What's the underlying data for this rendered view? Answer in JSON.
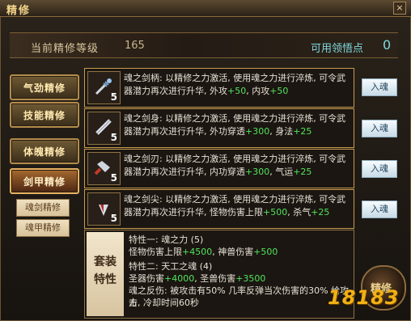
{
  "window": {
    "title": "精修",
    "close_label": "×"
  },
  "level": {
    "label": "当前精修等级",
    "value": "165",
    "points_label": "可用领悟点",
    "points_value": "0"
  },
  "tabs": [
    "气劲精修",
    "技能精修",
    "体魄精修",
    "剑甲精修"
  ],
  "subtabs": [
    "魂剑精修",
    "魂甲精修"
  ],
  "rows": [
    {
      "name": "魂之剑柄",
      "level": "5",
      "line1": "魂之剑柄: 以精修之力激活, 使用魂之力进行淬炼, 可令武",
      "line2a": "器潜力再次进行升华, 外攻",
      "g1": "+50",
      "mid": ", 内攻",
      "g2": "+50",
      "button": "入魂",
      "icon": "sword-hilt-icon"
    },
    {
      "name": "魂之剑身",
      "level": "5",
      "line1": "魂之剑身: 以精修之力激活, 使用魂之力进行淬炼, 可令武",
      "line2a": "器潜力再次进行升华, 外功穿透",
      "g1": "+300",
      "mid": ", 身法",
      "g2": "+25",
      "button": "入魂",
      "icon": "sword-blade-icon"
    },
    {
      "name": "魂之剑刃",
      "level": "5",
      "line1": "魂之剑刃: 以精修之力激活, 使用魂之力进行淬炼, 可令武",
      "line2a": "器潜力再次进行升华, 内功穿透",
      "g1": "+300",
      "mid": ", 气运",
      "g2": "+25",
      "button": "入魂",
      "icon": "sword-edge-icon"
    },
    {
      "name": "魂之剑尖",
      "level": "5",
      "line1": "魂之剑尖: 以精修之力激活, 使用魂之力进行淬炼, 可令武",
      "line2a": "器潜力再次进行升华, 怪物伤害上限",
      "g1": "+500",
      "mid": ", 杀气",
      "g2": "+25",
      "button": "入魂",
      "icon": "sword-tip-icon"
    }
  ],
  "set": {
    "label1": "套装",
    "label2": "特性",
    "t1": "特性一: 魂之力 (5)",
    "t1a": "怪物伤害上限",
    "t1av": "+4500",
    "t1b": ", 神兽伤害",
    "t1bv": "+500",
    "t2": "特性二: 天工之魂 (4)",
    "t2a": "圣器伤害",
    "t2av": "+4000",
    "t2b": ", 圣兽伤害",
    "t2bv": "+3500",
    "t2c": "魂之反伤: 被攻击有50% 几率反弹当次伤害的30% 给攻击",
    "t2d": "方, 冷却时间60秒"
  },
  "orb_label": "精修",
  "watermark": "18183"
}
